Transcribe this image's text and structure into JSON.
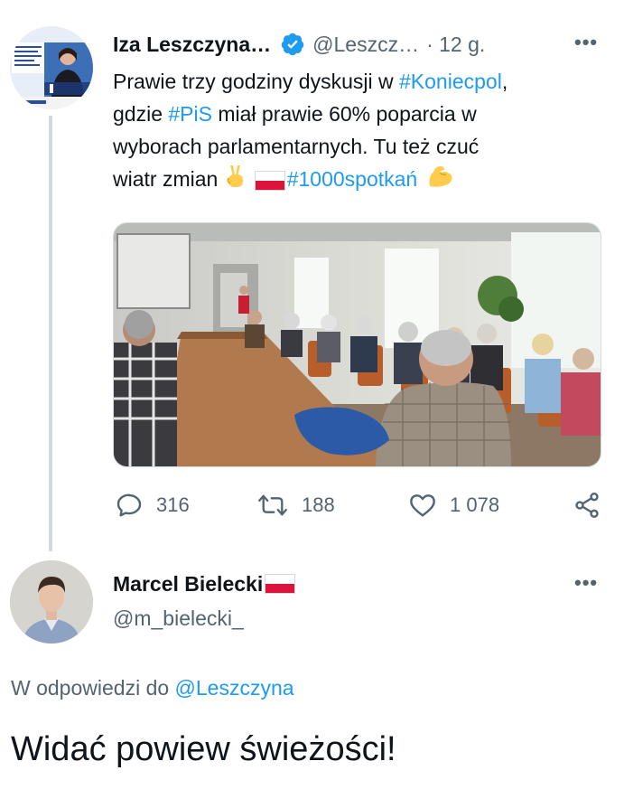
{
  "tweet1": {
    "author_name": "Iza Leszczyna…",
    "handle": "@Leszcz…",
    "time": "· 12 g.",
    "text_part1": "Prawie trzy godziny dyskusji w ",
    "tag1": "#Koniecpol",
    "text_part2": ",",
    "text_part3": "gdzie ",
    "tag2": "#PiS",
    "text_part4": " miał prawie 60% poparcia w",
    "text_line3": "wyborach parlamentarnych. Tu też czuć",
    "text_part5": "wiatr zmian ",
    "tag3": "#1000spotkań",
    "emoji_victory": "victory-hand-emoji",
    "emoji_flag": "poland-flag-emoji",
    "emoji_muscle": "flexed-biceps-emoji",
    "avatar_texts": [
      "Platforma",
      "Obywatelska",
      "Leszczyna"
    ],
    "stats": {
      "replies": "316",
      "retweets": "188",
      "likes": "1 078"
    }
  },
  "tweet2": {
    "author_name": "Marcel Bielecki",
    "handle": "@m_bielecki_",
    "reply_prefix": "W odpowiedzi do ",
    "reply_to": "@Leszczyna",
    "text": "Widać powiew świeżości!"
  },
  "colors": {
    "accent": "#1d9bf0",
    "muted": "#536471",
    "text": "#0f1419",
    "thread_line": "#cfd9de",
    "flag_red": "#dc143c"
  }
}
